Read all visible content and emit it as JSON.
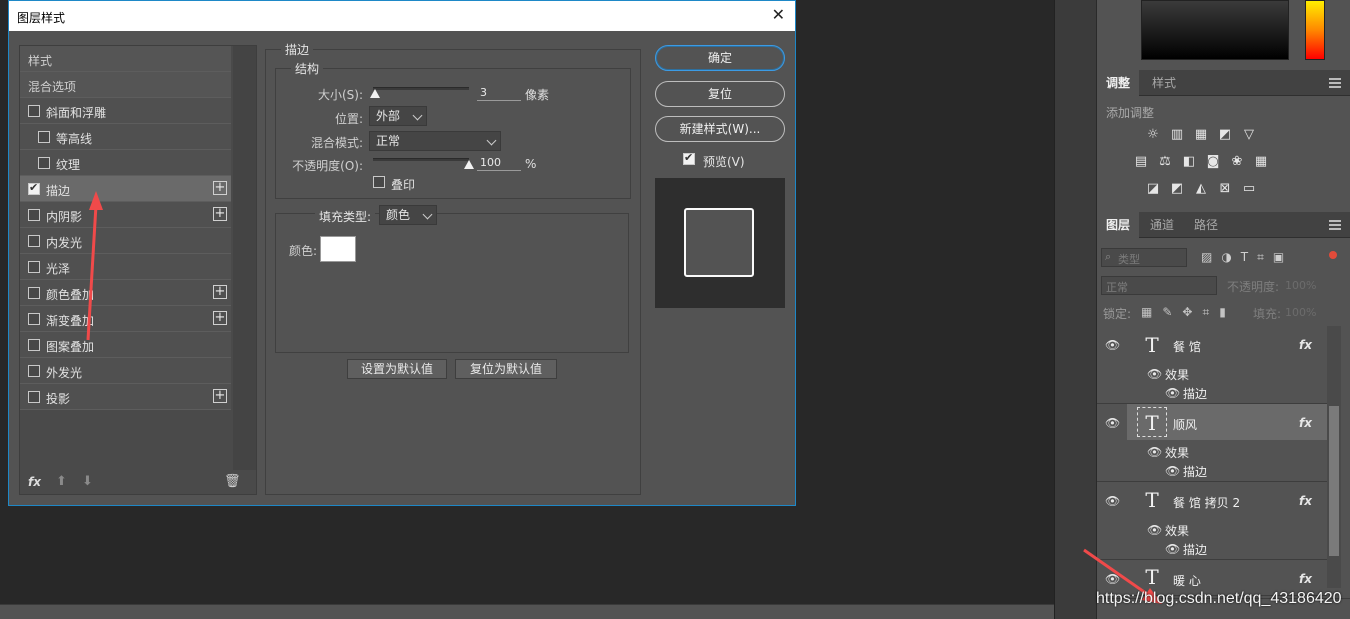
{
  "dialog": {
    "title": "图层样式",
    "close_label": "✕",
    "styles_list": [
      {
        "label": "样式",
        "kind": "header"
      },
      {
        "label": "混合选项",
        "kind": "header"
      },
      {
        "label": "斜面和浮雕",
        "checked": false,
        "plus": false,
        "indent": 0
      },
      {
        "label": "等高线",
        "checked": false,
        "plus": false,
        "indent": 1
      },
      {
        "label": "纹理",
        "checked": false,
        "plus": false,
        "indent": 1
      },
      {
        "label": "描边",
        "checked": true,
        "plus": true,
        "indent": 0,
        "active": true
      },
      {
        "label": "内阴影",
        "checked": false,
        "plus": true,
        "indent": 0
      },
      {
        "label": "内发光",
        "checked": false,
        "plus": false,
        "indent": 0
      },
      {
        "label": "光泽",
        "checked": false,
        "plus": false,
        "indent": 0
      },
      {
        "label": "颜色叠加",
        "checked": false,
        "plus": true,
        "indent": 0
      },
      {
        "label": "渐变叠加",
        "checked": false,
        "plus": true,
        "indent": 0
      },
      {
        "label": "图案叠加",
        "checked": false,
        "plus": false,
        "indent": 0
      },
      {
        "label": "外发光",
        "checked": false,
        "plus": false,
        "indent": 0
      },
      {
        "label": "投影",
        "checked": false,
        "plus": true,
        "indent": 0
      }
    ],
    "footer": {
      "fx_label": "fx",
      "up_icon": "arrow-up-icon",
      "down_icon": "arrow-down-icon",
      "trash_icon": "trash-icon"
    },
    "stroke": {
      "group_title": "描边",
      "structure_title": "结构",
      "size_label": "大小(S):",
      "size_value": "3",
      "size_unit": "像素",
      "size_fraction": 0.02,
      "position_label": "位置:",
      "position_value": "外部",
      "blend_label": "混合模式:",
      "blend_value": "正常",
      "opacity_label": "不透明度(O):",
      "opacity_value": "100",
      "opacity_unit": "%",
      "opacity_fraction": 1.0,
      "overprint_label": "叠印",
      "overprint_checked": false,
      "fill_type_label": "填充类型:",
      "fill_type_value": "颜色",
      "color_label": "颜色:",
      "color_value": "#ffffff",
      "set_default_label": "设置为默认值",
      "reset_default_label": "复位为默认值"
    },
    "buttons": {
      "ok": "确定",
      "reset": "复位",
      "new_style": "新建样式(W)...",
      "preview_label": "预览(V)",
      "preview_checked": true
    }
  },
  "right_panel": {
    "adjust_tabs": [
      "调整",
      "样式"
    ],
    "add_adjustment_label": "添加调整",
    "layers_tabs": [
      "图层",
      "通道",
      "路径"
    ],
    "filter_placeholder": "类型",
    "blend_mode": "正常",
    "opacity_label": "不透明度:",
    "opacity_value": "100%",
    "lock_label": "锁定:",
    "fill_label": "填充:",
    "fill_value": "100%",
    "layers": [
      {
        "name": "餐 馆",
        "effects_label": "效果",
        "effect": "描边",
        "selected": false
      },
      {
        "name": "顺风",
        "effects_label": "效果",
        "effect": "描边",
        "selected": true
      },
      {
        "name": "餐 馆 拷贝 2",
        "effects_label": "效果",
        "effect": "描边",
        "selected": false
      },
      {
        "name": "暖 心",
        "effects_label": "",
        "effect": "",
        "selected": false
      }
    ],
    "fx_label": "fx"
  },
  "watermark": "https://blog.csdn.net/qq_43186420",
  "colors": {
    "accent": "#1e88c7",
    "panel": "#535353",
    "arrow": "#f04a4a"
  }
}
